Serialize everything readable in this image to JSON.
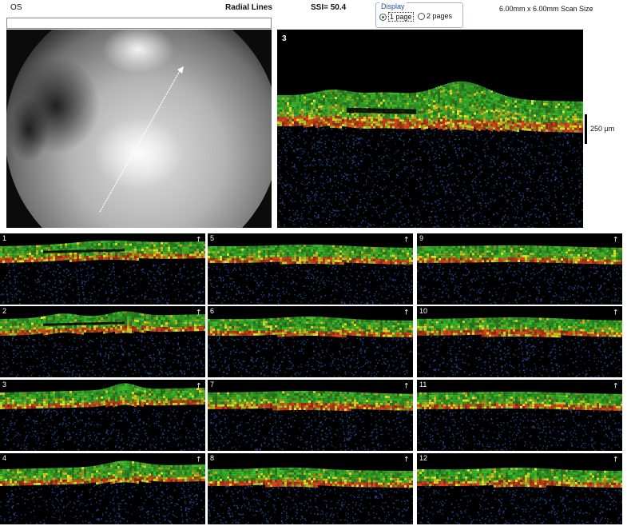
{
  "header": {
    "eye": "OS",
    "scan_mode": "Radial Lines",
    "ssi": "SSI= 50.4",
    "scan_size": "6.00mm x 6.00mm Scan Size"
  },
  "display": {
    "title": "Display",
    "options": [
      {
        "label": "1 page",
        "selected": true
      },
      {
        "label": "2 pages",
        "selected": false
      }
    ]
  },
  "main_scan": {
    "label": "3",
    "scale_label": "250 µm"
  },
  "thumbnails": [
    {
      "label": "1"
    },
    {
      "label": "2"
    },
    {
      "label": "3"
    },
    {
      "label": "4"
    },
    {
      "label": "5"
    },
    {
      "label": "6"
    },
    {
      "label": "7"
    },
    {
      "label": "8"
    },
    {
      "label": "9"
    },
    {
      "label": "10"
    },
    {
      "label": "11"
    },
    {
      "label": "12"
    }
  ],
  "colors": {
    "retina_green": "#3fbf2e",
    "retina_yellow": "#e6e62a",
    "retina_red": "#e24a1e",
    "noise_blue": "#2a4fa0",
    "ui_border": "#9ab7d8"
  }
}
